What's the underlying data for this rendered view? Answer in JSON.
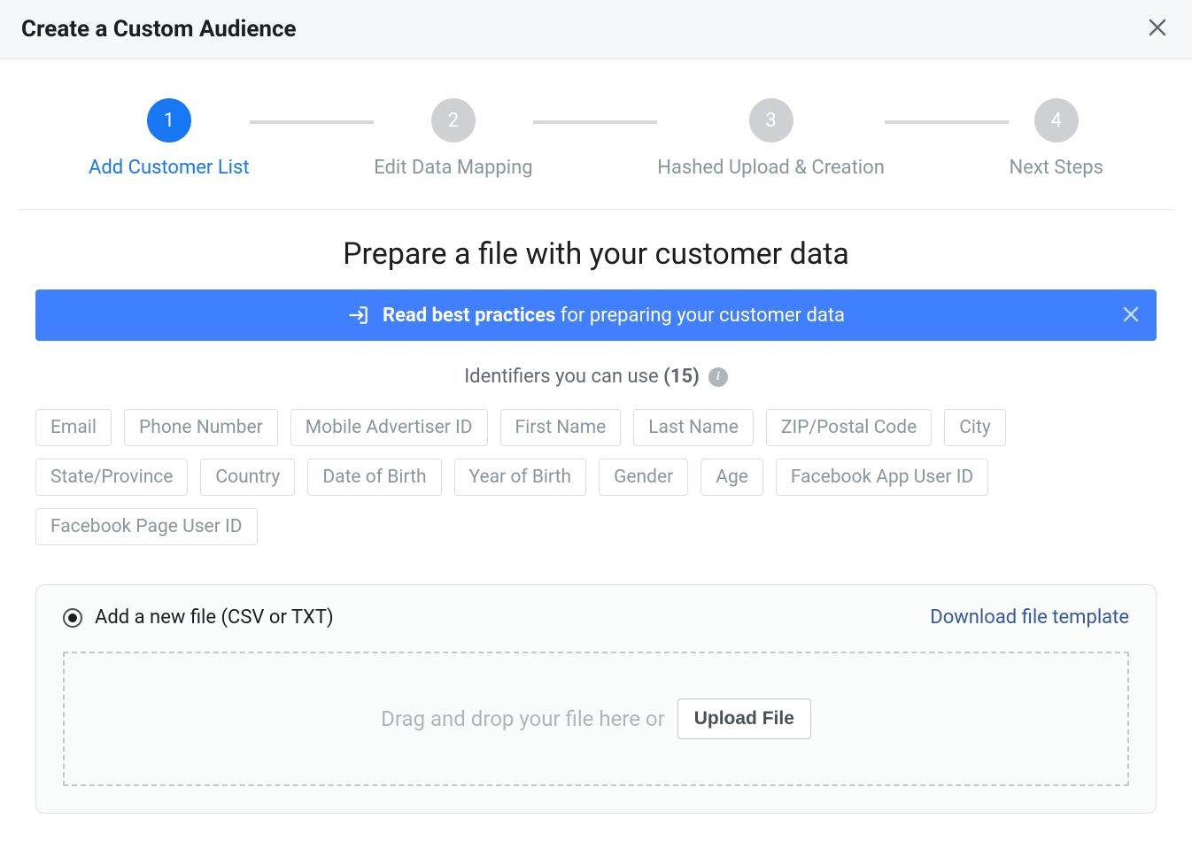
{
  "header": {
    "title": "Create a Custom Audience"
  },
  "stepper": {
    "steps": [
      {
        "num": "1",
        "label": "Add Customer List",
        "active": true
      },
      {
        "num": "2",
        "label": "Edit Data Mapping",
        "active": false
      },
      {
        "num": "3",
        "label": "Hashed Upload & Creation",
        "active": false
      },
      {
        "num": "4",
        "label": "Next Steps",
        "active": false
      }
    ]
  },
  "main": {
    "heading": "Prepare a file with your customer data",
    "banner_bold": "Read best practices",
    "banner_rest": " for preparing your customer data",
    "identifiers_label": "Identifiers you can use ",
    "identifiers_count": "(15)",
    "chips": [
      "Email",
      "Phone Number",
      "Mobile Advertiser ID",
      "First Name",
      "Last Name",
      "ZIP/Postal Code",
      "City",
      "State/Province",
      "Country",
      "Date of Birth",
      "Year of Birth",
      "Gender",
      "Age",
      "Facebook App User ID",
      "Facebook Page User ID"
    ],
    "upload": {
      "radio_label": "Add a new file (CSV or TXT)",
      "download_link": "Download file template",
      "drop_text": "Drag and drop your file here or",
      "upload_button": "Upload File"
    }
  }
}
